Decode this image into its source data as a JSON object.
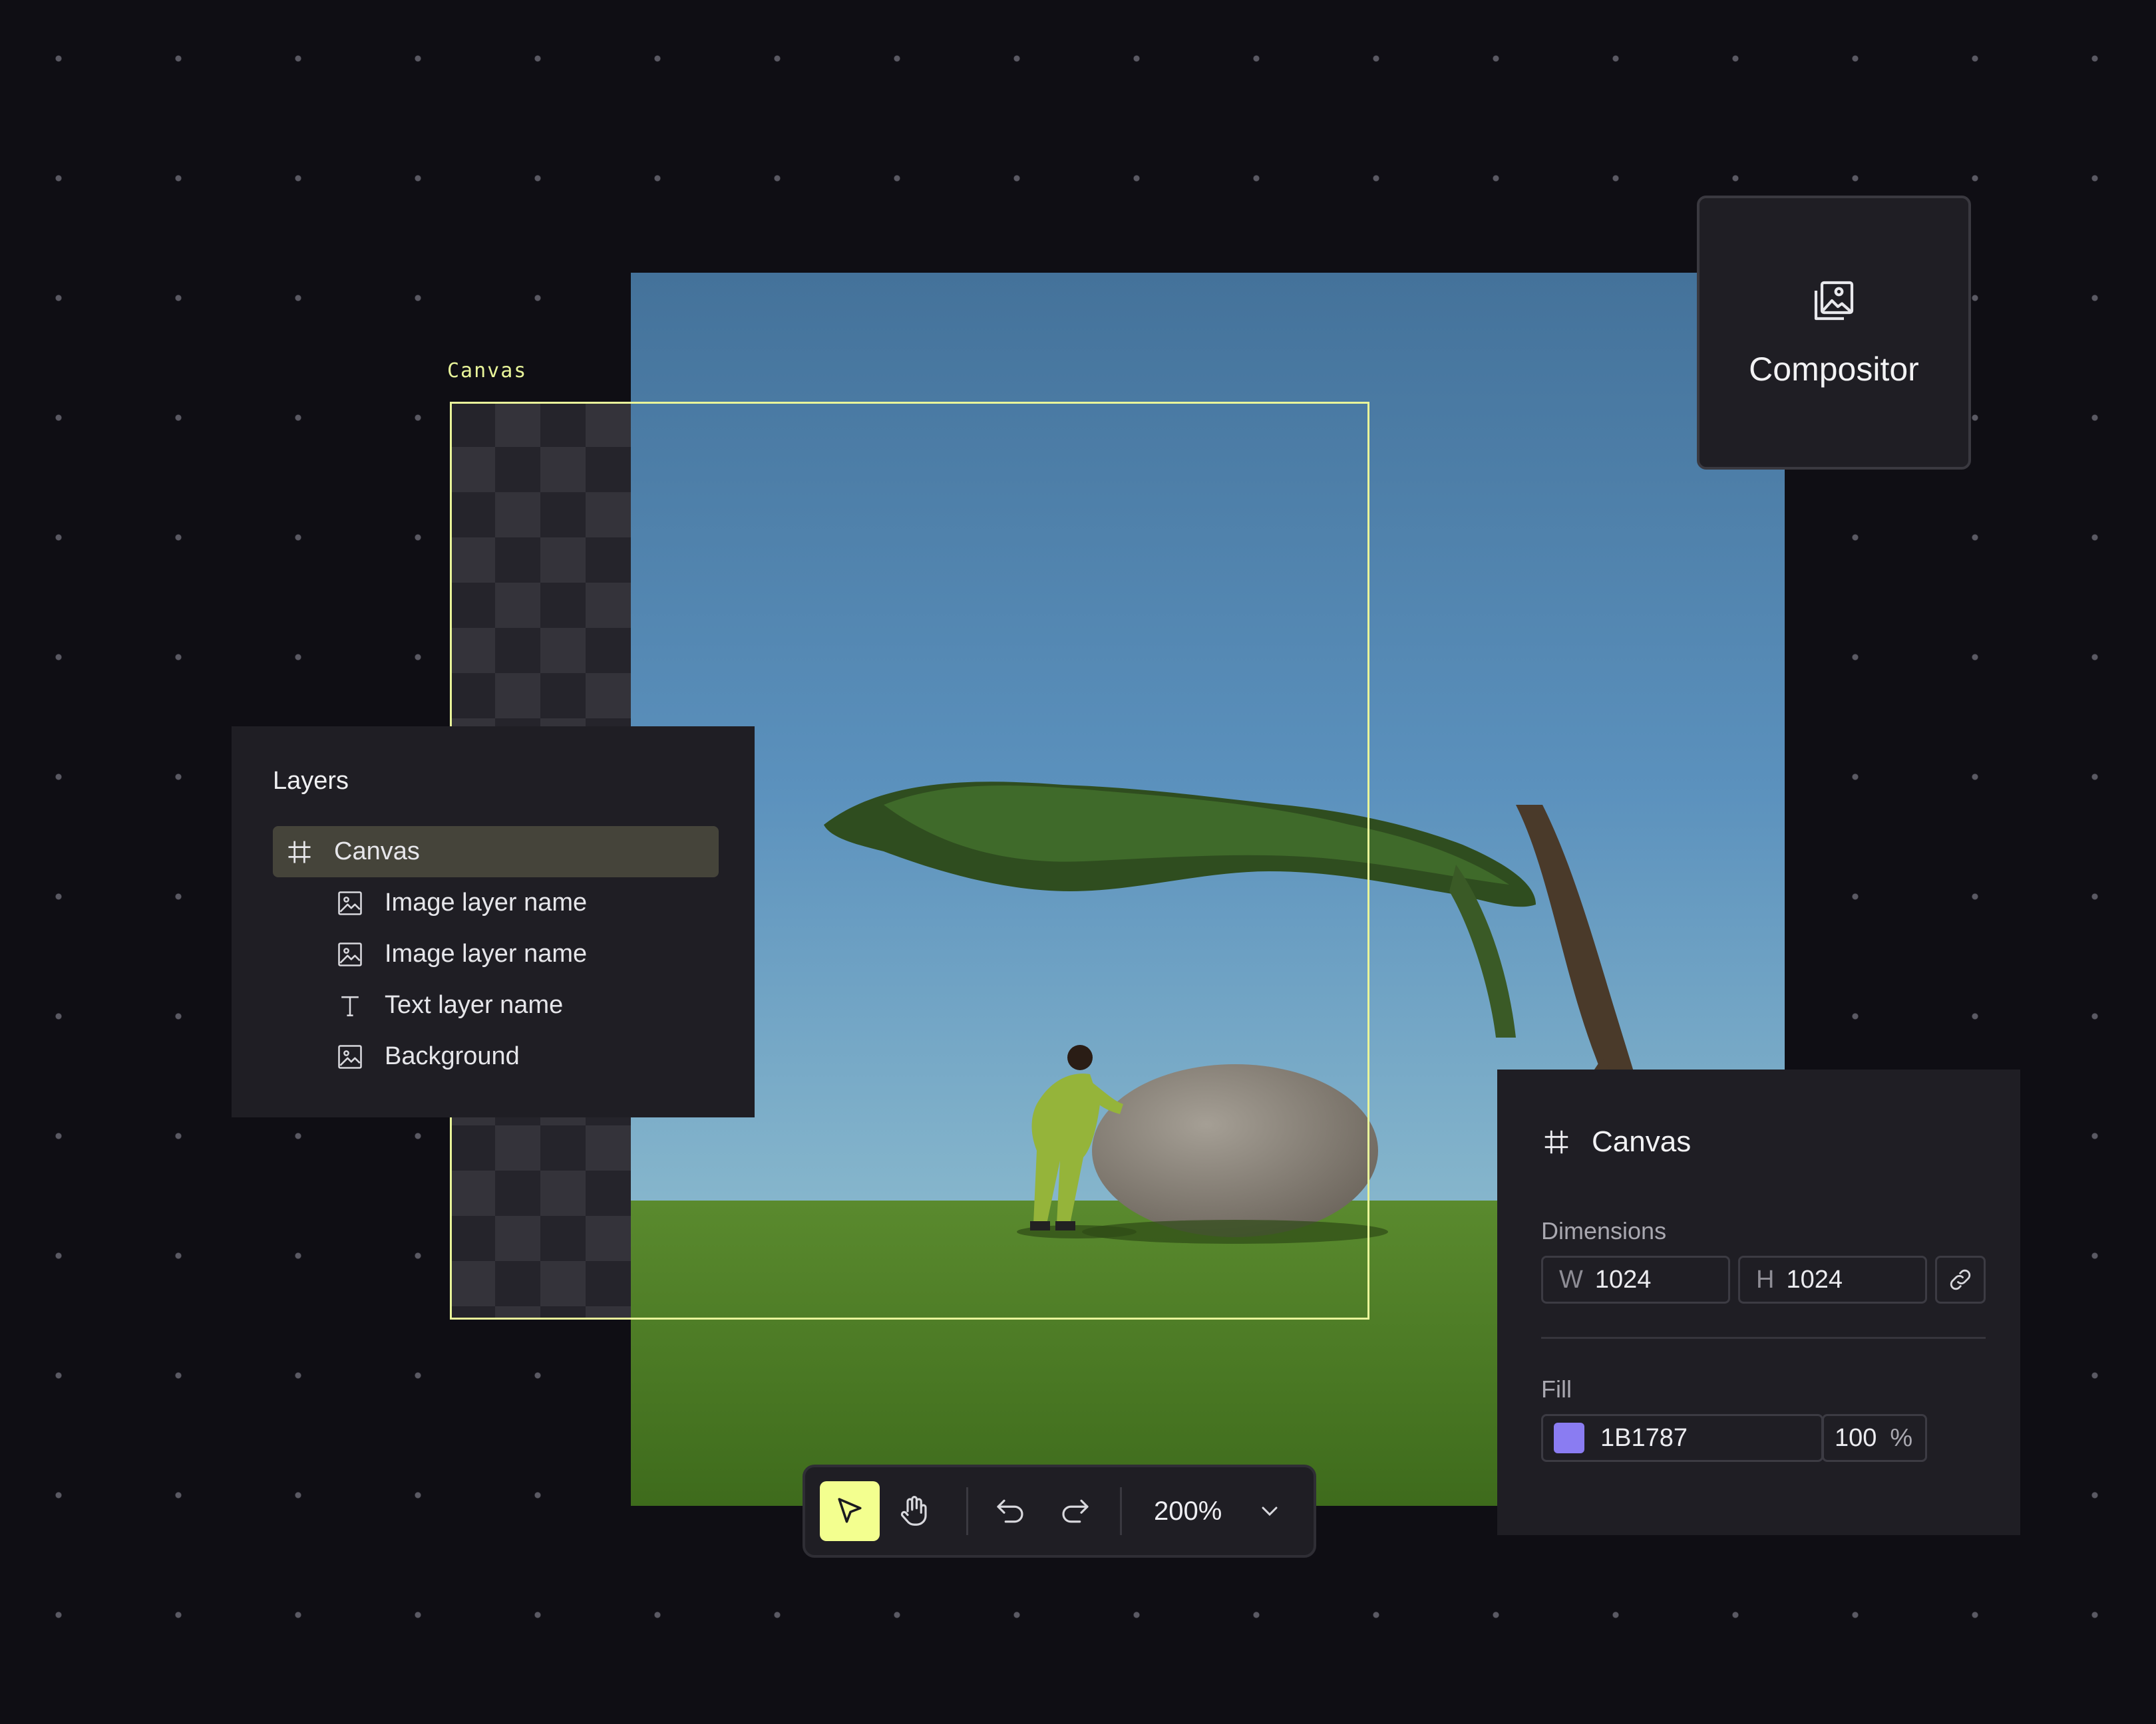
{
  "canvas_label": "Canvas",
  "compositor": {
    "title": "Compositor",
    "icon": "images-icon"
  },
  "layers": {
    "title": "Layers",
    "items": [
      {
        "label": "Canvas",
        "icon": "frame-hash-icon",
        "selected": true
      },
      {
        "label": "Image layer name",
        "icon": "image-icon"
      },
      {
        "label": "Image layer name",
        "icon": "image-icon"
      },
      {
        "label": "Text layer name",
        "icon": "text-icon"
      },
      {
        "label": "Background",
        "icon": "image-icon"
      }
    ]
  },
  "properties": {
    "title": "Canvas",
    "dimensions_label": "Dimensions",
    "width_prefix": "W",
    "width_value": "1024",
    "height_prefix": "H",
    "height_value": "1024",
    "fill_label": "Fill",
    "fill_hex": "1B1787",
    "fill_swatch_color": "#8a7cf2",
    "fill_opacity": "100",
    "fill_opacity_unit": "%"
  },
  "toolbar": {
    "zoom": "200%",
    "tools": [
      "select-pointer",
      "hand-pan",
      "undo",
      "redo"
    ]
  },
  "colors": {
    "accent": "#f3ff8f",
    "canvas_frame": "#e9f59a",
    "background": "#0f0e14",
    "panel": "#1f1e24"
  }
}
